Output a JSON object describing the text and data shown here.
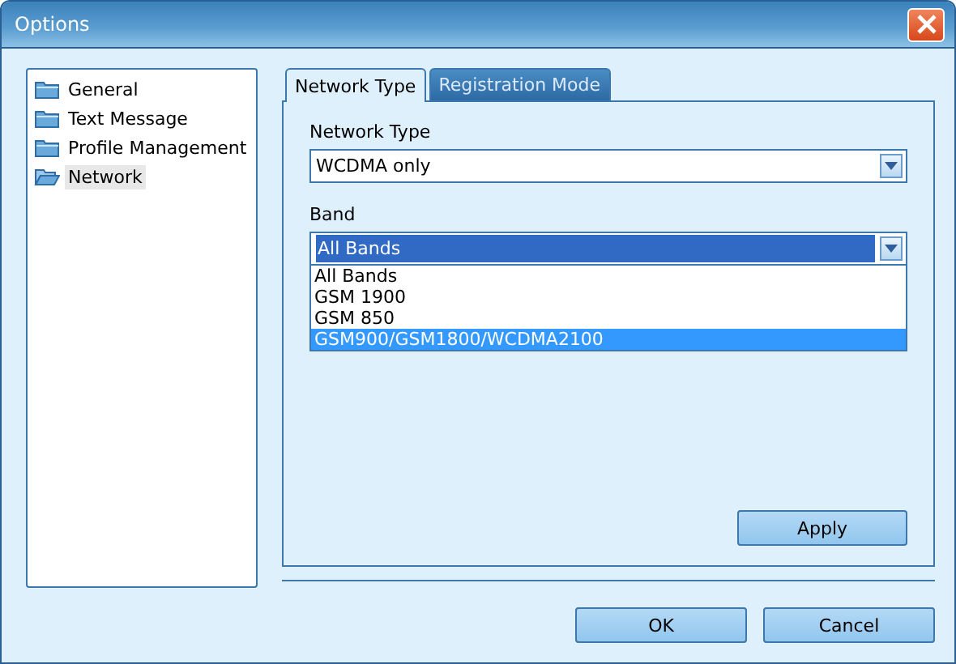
{
  "window": {
    "title": "Options"
  },
  "tree": [
    {
      "label": "General",
      "selected": false
    },
    {
      "label": "Text Message",
      "selected": false
    },
    {
      "label": "Profile Management",
      "selected": false
    },
    {
      "label": "Network",
      "selected": true
    }
  ],
  "tabs": [
    {
      "label": "Network Type",
      "selected": true
    },
    {
      "label": "Registration Mode",
      "selected": false
    }
  ],
  "network_type": {
    "label": "Network Type",
    "value": "WCDMA only"
  },
  "band": {
    "label": "Band",
    "value": "All Bands",
    "open": true,
    "options": [
      {
        "label": "All Bands",
        "highlighted": false
      },
      {
        "label": "GSM 1900",
        "highlighted": false
      },
      {
        "label": "GSM 850",
        "highlighted": false
      },
      {
        "label": "GSM900/GSM1800/WCDMA2100",
        "highlighted": true
      }
    ]
  },
  "apply_button": "Apply",
  "buttons": [
    "OK",
    "Cancel"
  ]
}
